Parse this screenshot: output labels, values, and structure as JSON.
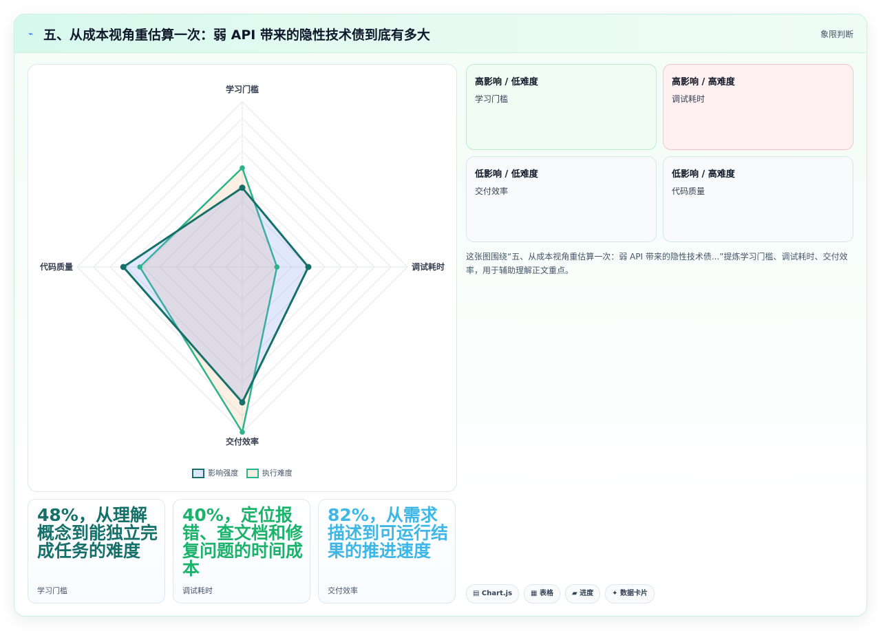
{
  "header": {
    "title": "五、从成本视角重估算一次：弱 API 带来的隐性技术债到底有多大",
    "tag": "象限判断"
  },
  "chart_data": {
    "type": "radar",
    "axes": [
      "学习门槛",
      "调试耗时",
      "交付效率",
      "代码质量"
    ],
    "rmax": 100,
    "series": [
      {
        "name": "影响强度",
        "values": [
          48,
          40,
          82,
          72
        ],
        "color": "#16706a"
      },
      {
        "name": "执行难度",
        "values": [
          60,
          21,
          100,
          62
        ],
        "color": "#2bb38a"
      }
    ]
  },
  "stats": [
    {
      "big": "48%，从理解概念到能独立完成任务的难度",
      "small": "学习门槛",
      "color": "#16706a"
    },
    {
      "big": "40%，定位报错、查文档和修复问题的时间成本",
      "small": "调试耗时",
      "color": "#1cb26b"
    },
    {
      "big": "82%，从需求描述到可运行结果的推进速度",
      "small": "交付效率",
      "color": "#3fb7e6"
    }
  ],
  "quadrants": [
    {
      "title": "高影响 / 低难度",
      "item": "学习门槛"
    },
    {
      "title": "高影响 / 高难度",
      "item": "调试耗时"
    },
    {
      "title": "低影响 / 低难度",
      "item": "交付效率"
    },
    {
      "title": "低影响 / 高难度",
      "item": "代码质量"
    }
  ],
  "description": "这张图围绕“五、从成本视角重估算一次：弱 API 带来的隐性技术债...”提炼学习门槛、调试耗时、交付效率，用于辅助理解正文重点。",
  "chips": [
    "▤ Chart.js",
    "▦ 表格",
    "▰ 进度",
    "✦ 数据卡片"
  ]
}
